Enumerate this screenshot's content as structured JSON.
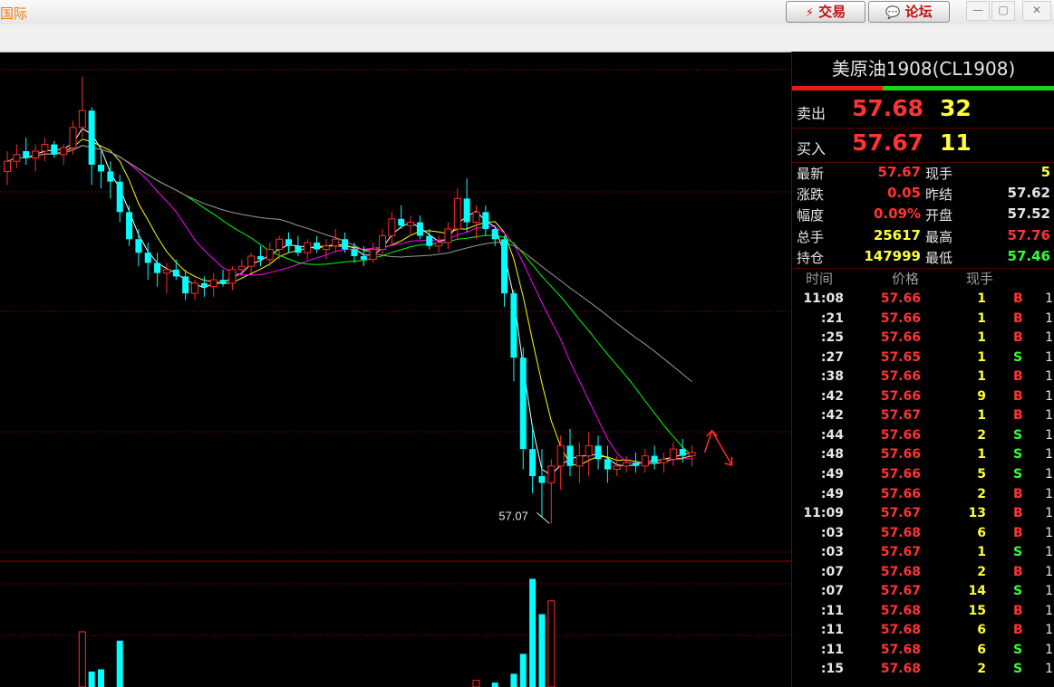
{
  "window": {
    "app_title": "国际",
    "trade_button": "交易",
    "forum_button": "论坛",
    "minimize": "—",
    "restore": "▢",
    "close": "✕"
  },
  "instrument": {
    "title": "美原油1908(CL1908)"
  },
  "quote": {
    "sell_label": "卖出",
    "sell_price": "57.68",
    "sell_volume": "32",
    "buy_label": "买入",
    "buy_price": "57.67",
    "buy_volume": "11"
  },
  "stats": [
    {
      "l_label": "最新",
      "l_value": "57.67",
      "l_color": "red",
      "r_label": "现手",
      "r_value": "5",
      "r_color": "yel"
    },
    {
      "l_label": "涨跌",
      "l_value": "0.05",
      "l_color": "red",
      "r_label": "昨结",
      "r_value": "57.62",
      "r_color": "wht"
    },
    {
      "l_label": "幅度",
      "l_value": "0.09%",
      "l_color": "red",
      "r_label": "开盘",
      "r_value": "57.52",
      "r_color": "wht"
    },
    {
      "l_label": "总手",
      "l_value": "25617",
      "l_color": "yel",
      "r_label": "最高",
      "r_value": "57.76",
      "r_color": "red"
    },
    {
      "l_label": "持仓",
      "l_value": "147999",
      "l_color": "yel",
      "r_label": "最低",
      "r_value": "57.46",
      "r_color": "grn"
    }
  ],
  "ticks_header": {
    "time": "时间",
    "price": "价格",
    "volume": "现手"
  },
  "ticks": [
    {
      "time": "11:08",
      "price": "57.66",
      "volume": "1",
      "side": "B",
      "count": "1"
    },
    {
      "time": ":21",
      "price": "57.66",
      "volume": "1",
      "side": "B",
      "count": "1"
    },
    {
      "time": ":25",
      "price": "57.66",
      "volume": "1",
      "side": "B",
      "count": "1"
    },
    {
      "time": ":27",
      "price": "57.65",
      "volume": "1",
      "side": "S",
      "count": "1"
    },
    {
      "time": ":38",
      "price": "57.66",
      "volume": "1",
      "side": "B",
      "count": "1"
    },
    {
      "time": ":42",
      "price": "57.66",
      "volume": "9",
      "side": "B",
      "count": "1"
    },
    {
      "time": ":42",
      "price": "57.67",
      "volume": "1",
      "side": "B",
      "count": "1"
    },
    {
      "time": ":44",
      "price": "57.66",
      "volume": "2",
      "side": "S",
      "count": "1"
    },
    {
      "time": ":48",
      "price": "57.66",
      "volume": "1",
      "side": "S",
      "count": "1"
    },
    {
      "time": ":49",
      "price": "57.66",
      "volume": "5",
      "side": "S",
      "count": "1"
    },
    {
      "time": ":49",
      "price": "57.66",
      "volume": "2",
      "side": "B",
      "count": "1"
    },
    {
      "time": "11:09",
      "price": "57.67",
      "volume": "13",
      "side": "B",
      "count": "1"
    },
    {
      "time": ":03",
      "price": "57.68",
      "volume": "6",
      "side": "B",
      "count": "1"
    },
    {
      "time": ":03",
      "price": "57.67",
      "volume": "1",
      "side": "S",
      "count": "1"
    },
    {
      "time": ":07",
      "price": "57.68",
      "volume": "2",
      "side": "B",
      "count": "1"
    },
    {
      "time": ":07",
      "price": "57.67",
      "volume": "14",
      "side": "S",
      "count": "1"
    },
    {
      "time": ":11",
      "price": "57.68",
      "volume": "15",
      "side": "B",
      "count": "1"
    },
    {
      "time": ":11",
      "price": "57.68",
      "volume": "6",
      "side": "B",
      "count": "1"
    },
    {
      "time": ":11",
      "price": "57.68",
      "volume": "6",
      "side": "S",
      "count": "1"
    },
    {
      "time": ":15",
      "price": "57.68",
      "volume": "2",
      "side": "S",
      "count": "1"
    }
  ],
  "chart_data": {
    "type": "candlestick",
    "min_label": "57.07",
    "colors": {
      "up": "#ff2a2a",
      "down": "#00ffff",
      "ma": [
        "#ffffff",
        "#ffff00",
        "#ff00ff",
        "#00ff00",
        "#9a9a9a"
      ]
    },
    "candles": [
      [
        57.5,
        57.56,
        57.46,
        57.53
      ],
      [
        57.53,
        57.58,
        57.51,
        57.55
      ],
      [
        57.56,
        57.6,
        57.52,
        57.54
      ],
      [
        57.54,
        57.58,
        57.5,
        57.56
      ],
      [
        57.56,
        57.6,
        57.53,
        57.58
      ],
      [
        57.58,
        57.59,
        57.54,
        57.55
      ],
      [
        57.55,
        57.58,
        57.52,
        57.57
      ],
      [
        57.57,
        57.65,
        57.55,
        57.63
      ],
      [
        57.63,
        57.78,
        57.6,
        57.68
      ],
      [
        57.68,
        57.69,
        57.46,
        57.52
      ],
      [
        57.52,
        57.56,
        57.45,
        57.5
      ],
      [
        57.5,
        57.53,
        57.42,
        57.47
      ],
      [
        57.47,
        57.49,
        57.35,
        57.38
      ],
      [
        57.38,
        57.4,
        57.28,
        57.3
      ],
      [
        57.3,
        57.33,
        57.22,
        57.26
      ],
      [
        57.26,
        57.29,
        57.18,
        57.23
      ],
      [
        57.23,
        57.26,
        57.16,
        57.2
      ],
      [
        57.2,
        57.23,
        57.14,
        57.21
      ],
      [
        57.21,
        57.24,
        57.18,
        57.19
      ],
      [
        57.19,
        57.21,
        57.12,
        57.14
      ],
      [
        57.14,
        57.18,
        57.12,
        57.17
      ],
      [
        57.17,
        57.19,
        57.13,
        57.16
      ],
      [
        57.16,
        57.2,
        57.13,
        57.18
      ],
      [
        57.18,
        57.21,
        57.16,
        57.17
      ],
      [
        57.17,
        57.22,
        57.15,
        57.21
      ],
      [
        57.21,
        57.24,
        57.19,
        57.22
      ],
      [
        57.22,
        57.26,
        57.2,
        57.25
      ],
      [
        57.25,
        57.28,
        57.22,
        57.24
      ],
      [
        57.24,
        57.29,
        57.22,
        57.27
      ],
      [
        57.27,
        57.31,
        57.24,
        57.3
      ],
      [
        57.3,
        57.32,
        57.26,
        57.28
      ],
      [
        57.28,
        57.31,
        57.25,
        57.26
      ],
      [
        57.26,
        57.3,
        57.24,
        57.29
      ],
      [
        57.29,
        57.31,
        57.26,
        57.27
      ],
      [
        57.27,
        57.3,
        57.24,
        57.28
      ],
      [
        57.28,
        57.33,
        57.26,
        57.3
      ],
      [
        57.3,
        57.32,
        57.26,
        57.27
      ],
      [
        57.27,
        57.29,
        57.23,
        57.25
      ],
      [
        57.25,
        57.28,
        57.22,
        57.24
      ],
      [
        57.24,
        57.29,
        57.23,
        57.27
      ],
      [
        57.27,
        57.33,
        57.25,
        57.31
      ],
      [
        57.31,
        57.38,
        57.28,
        57.36
      ],
      [
        57.36,
        57.4,
        57.33,
        57.34
      ],
      [
        57.34,
        57.37,
        57.31,
        57.35
      ],
      [
        57.35,
        57.37,
        57.3,
        57.31
      ],
      [
        57.31,
        57.33,
        57.27,
        57.28
      ],
      [
        57.28,
        57.31,
        57.26,
        57.29
      ],
      [
        57.29,
        57.35,
        57.27,
        57.33
      ],
      [
        57.33,
        57.45,
        57.3,
        57.42
      ],
      [
        57.42,
        57.48,
        57.32,
        57.35
      ],
      [
        57.35,
        57.4,
        57.3,
        57.38
      ],
      [
        57.38,
        57.4,
        57.31,
        57.33
      ],
      [
        57.33,
        57.34,
        57.28,
        57.3
      ],
      [
        57.3,
        57.31,
        57.1,
        57.14
      ],
      [
        57.14,
        57.15,
        56.88,
        56.95
      ],
      [
        56.95,
        56.98,
        56.62,
        56.68
      ],
      [
        56.68,
        56.75,
        56.55,
        56.6
      ],
      [
        56.6,
        56.68,
        56.48,
        56.58
      ],
      [
        56.58,
        56.65,
        56.46,
        56.63
      ],
      [
        56.63,
        56.72,
        56.56,
        56.69
      ],
      [
        56.69,
        56.74,
        56.6,
        56.63
      ],
      [
        56.63,
        56.7,
        56.58,
        56.66
      ],
      [
        56.66,
        56.73,
        56.6,
        56.69
      ],
      [
        56.69,
        56.72,
        56.62,
        56.65
      ],
      [
        56.65,
        56.69,
        56.58,
        56.62
      ],
      [
        56.62,
        56.66,
        56.6,
        56.63
      ],
      [
        56.63,
        56.66,
        56.61,
        56.64
      ],
      [
        56.64,
        56.67,
        56.61,
        56.63
      ],
      [
        56.63,
        56.68,
        56.61,
        56.66
      ],
      [
        56.66,
        56.69,
        56.62,
        56.64
      ],
      [
        56.64,
        56.67,
        56.61,
        56.65
      ],
      [
        56.65,
        56.7,
        56.63,
        56.68
      ],
      [
        56.68,
        56.71,
        56.64,
        56.66
      ],
      [
        56.66,
        56.69,
        56.63,
        56.67
      ]
    ],
    "volumes": [
      {
        "i": 8,
        "v": 50
      },
      {
        "i": 12,
        "v": 42
      },
      {
        "i": 9,
        "v": 14
      },
      {
        "i": 10,
        "v": 16
      },
      {
        "i": 50,
        "v": 6
      },
      {
        "i": 52,
        "v": 4
      },
      {
        "i": 55,
        "v": 30
      },
      {
        "i": 56,
        "v": 98
      },
      {
        "i": 57,
        "v": 66
      },
      {
        "i": 58,
        "v": 78
      },
      {
        "i": 54,
        "v": 12
      }
    ]
  }
}
